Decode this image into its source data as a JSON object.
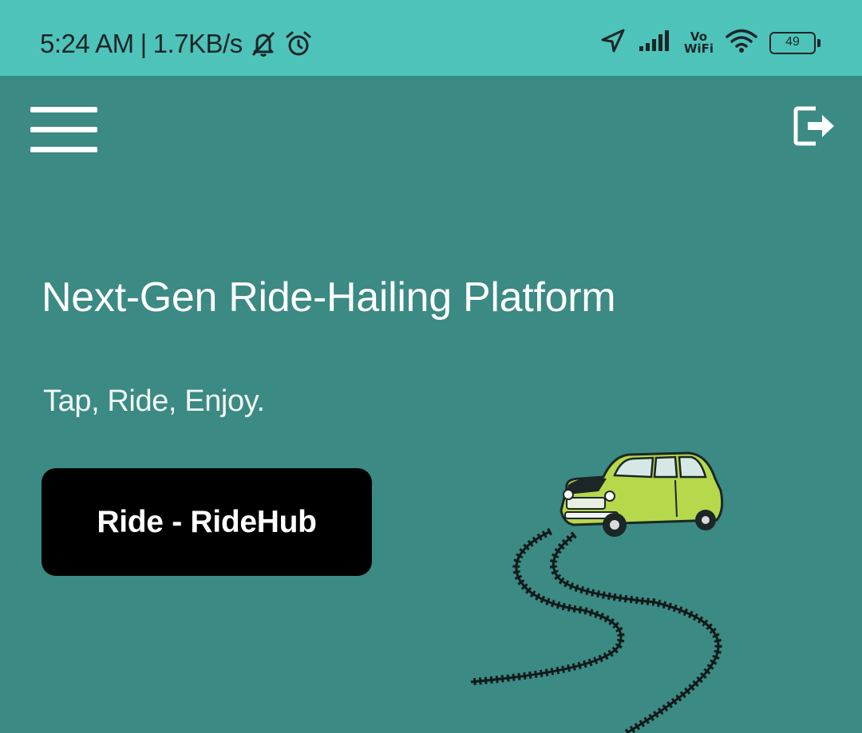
{
  "status_bar": {
    "time": "5:24 AM",
    "separator": "|",
    "network_speed": "1.7KB/s",
    "icons_left": [
      "notifications-off-icon",
      "alarm-icon"
    ],
    "icons_right": [
      "location-arrow-icon",
      "cell-signal-icon",
      "vowifi-icon",
      "wifi-icon",
      "battery-icon"
    ],
    "volte_line1": "Vo",
    "volte_line2": "WiFi",
    "battery_level": "49"
  },
  "header": {
    "menu_icon": "hamburger-menu-icon",
    "logout_icon": "logout-icon"
  },
  "hero": {
    "title": "Next-Gen Ride-Hailing Platform",
    "subtitle": "Tap, Ride, Enjoy.",
    "cta_label": "Ride - RideHub",
    "illustration": "green-car-with-tire-tracks"
  },
  "colors": {
    "status_bar_bg": "#4ec3ba",
    "page_bg": "#3b8a83",
    "button_bg": "#000000",
    "text": "#ffffff",
    "car_body": "#b5d94a"
  }
}
